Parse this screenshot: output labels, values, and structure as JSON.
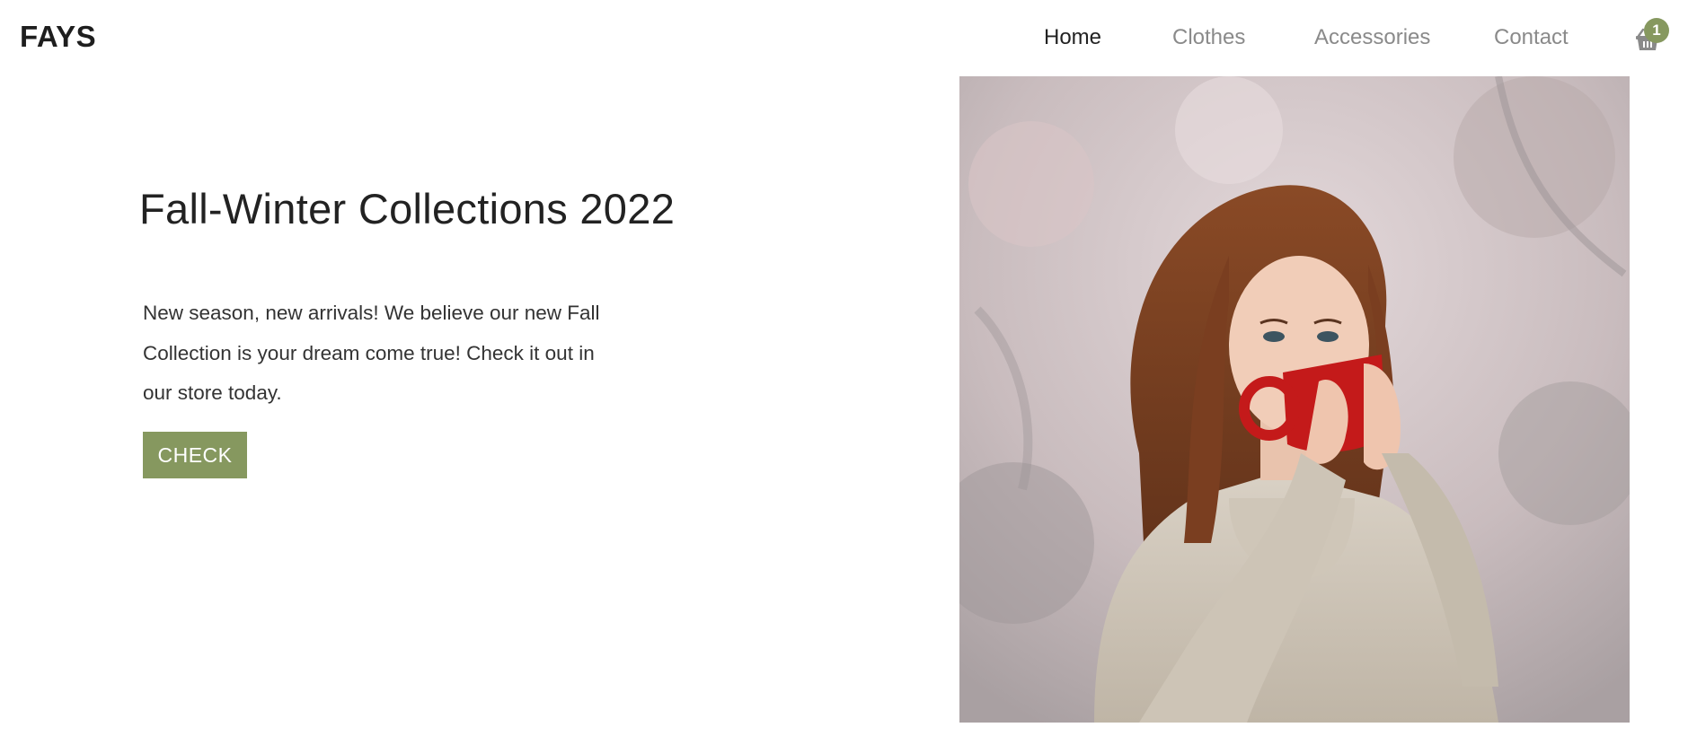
{
  "header": {
    "logo": "FAYS",
    "nav": [
      {
        "label": "Home",
        "active": true
      },
      {
        "label": "Clothes",
        "active": false
      },
      {
        "label": "Accessories",
        "active": false
      },
      {
        "label": "Contact",
        "active": false
      }
    ],
    "cart": {
      "icon": "basket-icon",
      "count": "1"
    }
  },
  "hero": {
    "title": "Fall-Winter Collections 2022",
    "text_lines": [
      "New season, new arrivals! We believe our new Fall",
      "Collection is your dream come true! Check it out in",
      "our store today."
    ],
    "button_label": "CHECK",
    "image": {
      "subject": "woman-drinking-from-red-mug-photo"
    }
  },
  "colors": {
    "accent": "#86985f",
    "text_dark": "#222222",
    "nav_inactive": "#8a8a8a",
    "background": "#ffffff"
  }
}
